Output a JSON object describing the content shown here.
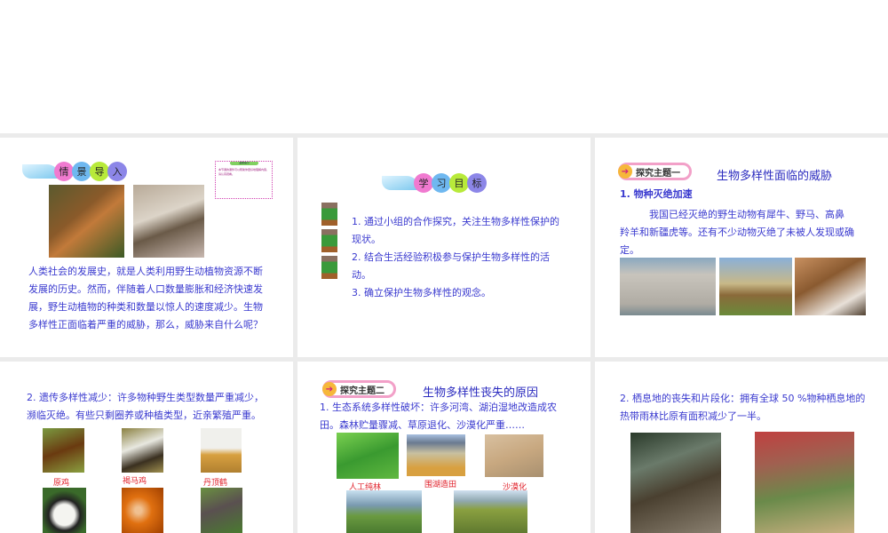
{
  "slides": [
    {
      "banner": [
        "情",
        "景",
        "导",
        "入"
      ],
      "tip": {
        "title": "温馨提示",
        "text": "本节课的课件可以帮助你更好地理解内容，请认真观看。"
      },
      "paragraph": [
        "人类社会的发展史，就是人类利用野生动植物资源不断",
        "发展的历史。然而，伴随着人口数量膨胀和经济快速发",
        "展，野生动植物的种类和数量以惊人的速度减少。生物",
        "多样性正面临着严重的威胁，那么，威胁来自什么呢？"
      ]
    },
    {
      "banner": [
        "学",
        "习",
        "目",
        "标"
      ],
      "lines": [
        "1. 通过小组的合作探究，关注生物多样性保护的",
        "现状。",
        "2. 结合生活经验积极参与保护生物多样性的活",
        "动。",
        "3. 确立保护生物多样性的观念。"
      ]
    },
    {
      "tag": "探究主题一",
      "title": "生物多样性面临的威胁",
      "subtitle": "1. 物种灭绝加速",
      "paragraph": [
        "　　　我国已经灭绝的野生动物有犀牛、野马、高鼻",
        "羚羊和新疆虎等。还有不少动物灭绝了未被人发现或确",
        "定。"
      ]
    },
    {
      "paragraph": [
        "2. 遗传多样性减少：许多物种野生类型数量严重减少，",
        "濒临灭绝。有些只剩圈养或种植类型，近亲繁殖严重。"
      ],
      "labels": [
        "原鸡",
        "褐马鸡",
        "丹顶鹤"
      ]
    },
    {
      "tag": "探究主题二",
      "title": "生物多样性丧失的原因",
      "paragraph": [
        "1. 生态系统多样性破坏：许多河湾、湖泊湿地改造成农",
        "田。森林贮量骤减、草原退化、沙漠化严重……"
      ],
      "labels": [
        "人工纯林",
        "围湖造田",
        "沙漠化"
      ]
    },
    {
      "paragraph": [
        "2. 栖息地的丧失和片段化：拥有全球 50 %物种栖息地的",
        "热带雨林比原有面积减少了一半。"
      ]
    }
  ]
}
